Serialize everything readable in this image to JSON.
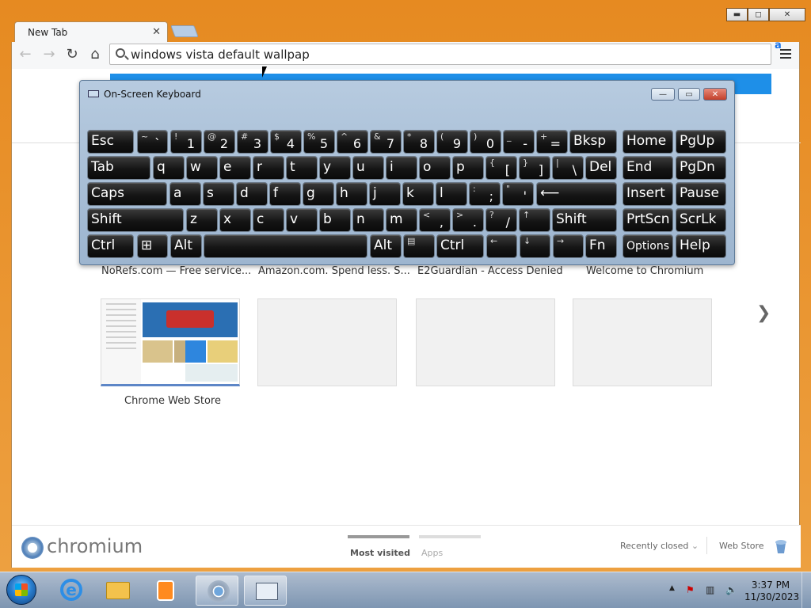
{
  "browser": {
    "tab_title": "New Tab",
    "omnibox_value": "windows vista default wallpap",
    "window_controls": {
      "minimize": "▬",
      "maximize": "◻",
      "close": "✕"
    }
  },
  "newtab": {
    "tiles_row1": [
      {
        "title": "NoRefs.com — Free service..."
      },
      {
        "title": "Amazon.com. Spend less. S..."
      },
      {
        "title": "E2Guardian - Access Denied"
      },
      {
        "title": "Welcome to Chromium"
      }
    ],
    "tiles_row2": [
      {
        "title": "Chrome Web Store"
      },
      {
        "title": ""
      },
      {
        "title": ""
      },
      {
        "title": ""
      }
    ],
    "next_page": "❯",
    "footer": {
      "logo": "chromium",
      "tabs": [
        {
          "label": "Most visited",
          "selected": true
        },
        {
          "label": "Apps",
          "selected": false
        }
      ],
      "recently_closed": "Recently closed",
      "web_store": "Web Store"
    }
  },
  "osk": {
    "title": "On-Screen Keyboard",
    "controls": {
      "minimize": "—",
      "maximize": "▭",
      "close": "✕"
    },
    "keys": {
      "esc": "Esc",
      "bksp": "Bksp",
      "home": "Home",
      "pgup": "PgUp",
      "tab": "Tab",
      "del": "Del",
      "end": "End",
      "pgdn": "PgDn",
      "caps": "Caps",
      "insert": "Insert",
      "pause": "Pause",
      "shift": "Shift",
      "prtscn": "PrtScn",
      "scrlk": "ScrLk",
      "ctrl": "Ctrl",
      "alt": "Alt",
      "fn": "Fn",
      "options": "Options",
      "help": "Help",
      "row1": [
        {
          "shift": "~",
          "base": "`"
        },
        {
          "shift": "!",
          "base": "1"
        },
        {
          "shift": "@",
          "base": "2"
        },
        {
          "shift": "#",
          "base": "3"
        },
        {
          "shift": "$",
          "base": "4"
        },
        {
          "shift": "%",
          "base": "5"
        },
        {
          "shift": "^",
          "base": "6"
        },
        {
          "shift": "&",
          "base": "7"
        },
        {
          "shift": "*",
          "base": "8"
        },
        {
          "shift": "(",
          "base": "9"
        },
        {
          "shift": ")",
          "base": "0"
        },
        {
          "shift": "_",
          "base": "-"
        },
        {
          "shift": "+",
          "base": "="
        }
      ],
      "row2": [
        "q",
        "w",
        "e",
        "r",
        "t",
        "y",
        "u",
        "i",
        "o",
        "p"
      ],
      "row2_extra": [
        {
          "shift": "{",
          "base": "["
        },
        {
          "shift": "}",
          "base": "]"
        },
        {
          "shift": "|",
          "base": "\\"
        }
      ],
      "row3": [
        "a",
        "s",
        "d",
        "f",
        "g",
        "h",
        "j",
        "k",
        "l"
      ],
      "row3_extra": [
        {
          "shift": ":",
          "base": ";"
        },
        {
          "shift": "\"",
          "base": "'"
        }
      ],
      "enter": "⟵",
      "row4": [
        "z",
        "x",
        "c",
        "v",
        "b",
        "n",
        "m"
      ],
      "row4_extra": [
        {
          "shift": "<",
          "base": ","
        },
        {
          "shift": ">",
          "base": "."
        },
        {
          "shift": "?",
          "base": "/"
        }
      ],
      "up": "↑",
      "left": "←",
      "down": "↓",
      "right": "→",
      "win": "⊞",
      "menu": "▤"
    }
  },
  "taskbar": {
    "time": "3:37 PM",
    "date": "11/30/2023",
    "tray_arrow": "▲"
  }
}
